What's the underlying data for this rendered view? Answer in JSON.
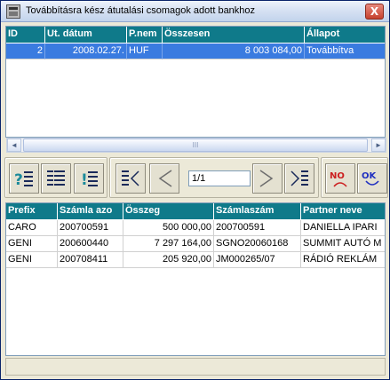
{
  "window": {
    "title": "Továbbításra kész átutalási csomagok adott bankhoz",
    "close_label": "X"
  },
  "top_grid": {
    "columns": [
      "ID",
      "Ut. dátum",
      "P.nem",
      "Összesen",
      "Állapot"
    ],
    "rows": [
      {
        "id": "2",
        "date": "2008.02.27.",
        "currency": "HUF",
        "total": "8 003 084,00",
        "status": "Továbbítva",
        "selected": true
      }
    ]
  },
  "toolbar": {
    "pager_value": "1/1",
    "no_label": "NO",
    "ok_label": "OK"
  },
  "bottom_grid": {
    "columns": [
      "Prefix",
      "Számla azo",
      "Összeg",
      "Számlaszám",
      "Partner neve"
    ],
    "rows": [
      {
        "prefix": "CARO",
        "account_id": "200700591",
        "amount": "500 000,00",
        "account_no": "200700591",
        "partner": "DANIELLA IPARI"
      },
      {
        "prefix": "GENI",
        "account_id": "200600440",
        "amount": "7 297 164,00",
        "account_no": "SGNO20060168",
        "partner": "SUMMIT AUTÓ M"
      },
      {
        "prefix": "GENI",
        "account_id": "200708411",
        "amount": "205 920,00",
        "account_no": "JM000265/07",
        "partner": "RÁDIÓ REKLÁM"
      }
    ]
  },
  "scrollbar": {
    "left_arrow": "◄",
    "right_arrow": "►",
    "grip": "III"
  },
  "colors": {
    "header_bg": "#0f7a8a",
    "selection_bg": "#3a7be0",
    "no_icon": "#cc2020",
    "ok_icon": "#2030c0"
  }
}
